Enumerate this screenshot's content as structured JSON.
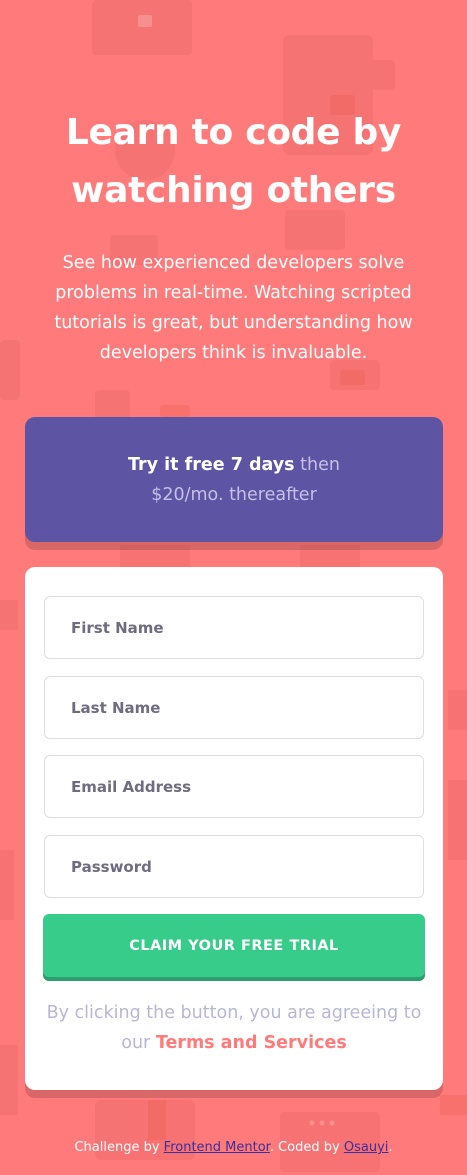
{
  "hero": {
    "title_line1": "Learn to code by",
    "title_line2": "watching others",
    "description": "See how experienced developers solve problems in real-time. Watching scripted tutorials is great, but understanding how developers think is invaluable."
  },
  "promo": {
    "bold": "Try it free 7 days",
    "rest": "then $20/mo. thereafter"
  },
  "form": {
    "first_name_placeholder": "First Name",
    "last_name_placeholder": "Last Name",
    "email_placeholder": "Email Address",
    "password_placeholder": "Password",
    "submit_label": "CLAIM YOUR FREE TRIAL",
    "terms_prefix": "By clicking the button, you are agreeing to our",
    "terms_link": "Terms and Services"
  },
  "footer": {
    "prefix": "Challenge by",
    "mentor_link": "Frontend Mentor",
    "middle": ". Coded by",
    "author_link": "Osauyi",
    "suffix": "."
  },
  "colors": {
    "background": "#ff7a7a",
    "promo": "#5e54a4",
    "cta": "#38cc8b",
    "text_muted": "#b9b6d3"
  }
}
